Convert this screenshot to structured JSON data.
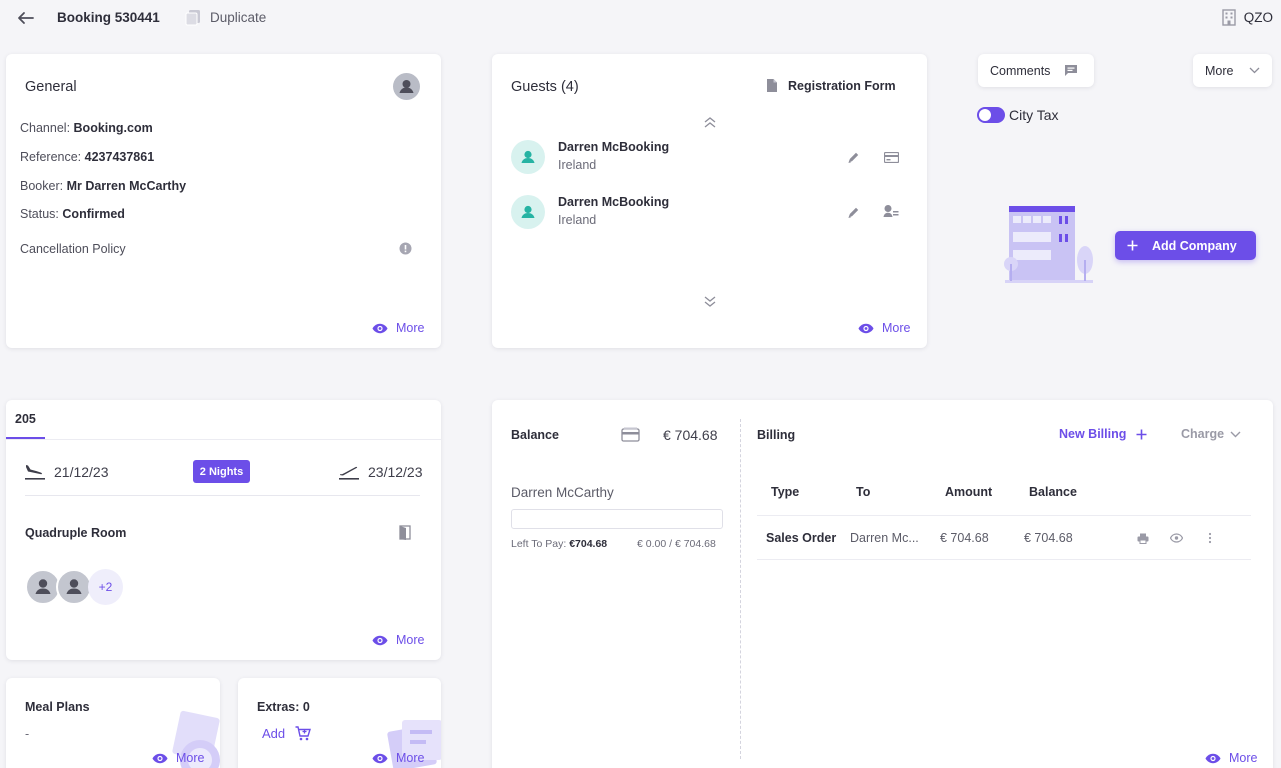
{
  "header": {
    "booking_title": "Booking 530441",
    "duplicate_label": "Duplicate",
    "property_code": "QZO"
  },
  "general": {
    "title": "General",
    "channel_label": "Channel:",
    "channel_value": "Booking.com",
    "reference_label": "Reference:",
    "reference_value": "4237437861",
    "booker_label": "Booker:",
    "booker_value": "Mr Darren McCarthy",
    "status_label": "Status:",
    "status_value": "Confirmed",
    "cancellation_label": "Cancellation Policy",
    "more_label": "More"
  },
  "guests": {
    "title": "Guests (4)",
    "registration_label": "Registration Form",
    "items": [
      {
        "name": "Darren McBooking",
        "country": "Ireland"
      },
      {
        "name": "Darren McBooking",
        "country": "Ireland"
      }
    ],
    "more_label": "More"
  },
  "actions": {
    "comments_label": "Comments",
    "more_label": "More",
    "city_tax_label": "City Tax",
    "add_company_label": "Add Company"
  },
  "room": {
    "tab_label": "205",
    "checkin_date": "21/12/23",
    "nights_label": "2 Nights",
    "checkout_date": "23/12/23",
    "room_type": "Quadruple Room",
    "extra_occupants": "+2",
    "more_label": "More"
  },
  "meal_plans": {
    "title": "Meal Plans",
    "value": "-",
    "more_label": "More"
  },
  "extras": {
    "title": "Extras: 0",
    "add_label": "Add",
    "more_label": "More"
  },
  "balance": {
    "label": "Balance",
    "amount": "€ 704.68",
    "payer_name": "Darren McCarthy",
    "left_to_pay_label": "Left To Pay:",
    "left_to_pay_value": "€704.68",
    "paid_ratio": "€ 0.00 / € 704.68"
  },
  "billing": {
    "title": "Billing",
    "new_billing_label": "New Billing",
    "charge_label": "Charge",
    "columns": [
      "Type",
      "To",
      "Amount",
      "Balance"
    ],
    "rows": [
      {
        "type": "Sales Order",
        "to": "Darren Mc...",
        "amount": "€ 704.68",
        "balance": "€ 704.68"
      }
    ],
    "more_label": "More"
  },
  "colors": {
    "accent": "#6c4ee8",
    "guest_avatar_bg": "#d8f2ef",
    "guest_avatar_icon": "#26b3a3"
  }
}
